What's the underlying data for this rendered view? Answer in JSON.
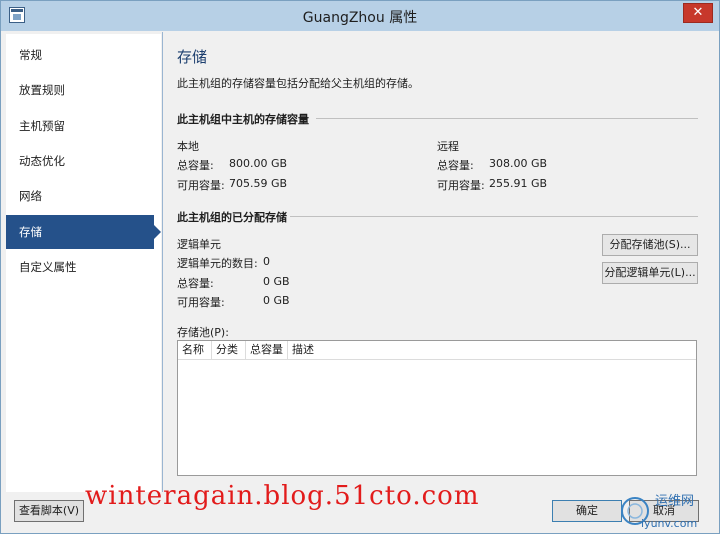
{
  "window": {
    "title": "GuangZhou 属性",
    "close_label": "✕"
  },
  "sidebar": {
    "items": [
      {
        "label": "常规"
      },
      {
        "label": "放置规则"
      },
      {
        "label": "主机预留"
      },
      {
        "label": "动态优化"
      },
      {
        "label": "网络"
      },
      {
        "label": "存储",
        "active": true
      },
      {
        "label": "自定义属性"
      }
    ]
  },
  "main": {
    "title": "存储",
    "description": "此主机组的存储容量包括分配给父主机组的存储。",
    "capacity_section": {
      "heading": "此主机组中主机的存储容量",
      "local": {
        "label": "本地",
        "total_label": "总容量:",
        "total_value": "800.00 GB",
        "available_label": "可用容量:",
        "available_value": "705.59 GB"
      },
      "remote": {
        "label": "远程",
        "total_label": "总容量:",
        "total_value": "308.00 GB",
        "available_label": "可用容量:",
        "available_value": "255.91 GB"
      }
    },
    "allocated_section": {
      "heading": "此主机组的已分配存储",
      "logical_unit_label": "逻辑单元",
      "count_label": "逻辑单元的数目:",
      "count_value": "0",
      "total_label": "总容量:",
      "total_value": "0 GB",
      "available_label": "可用容量:",
      "available_value": "0 GB",
      "allocate_pool_button": "分配存储池(S)...",
      "allocate_lun_button": "分配逻辑单元(L)..."
    },
    "pool": {
      "label": "存储池(P):",
      "columns": [
        "名称",
        "分类",
        "总容量",
        "描述"
      ]
    }
  },
  "footer": {
    "view_script_button": "查看脚本(V)",
    "ok_button": "确定",
    "cancel_button": "取消"
  },
  "overlay": {
    "watermark": "winteragain.blog.51cto.com",
    "logo_text": "运维网",
    "logo_url": "iyunv.com"
  },
  "colors": {
    "accent": "#25518a",
    "titlebar": "#b7d0e6",
    "close": "#c7382b",
    "watermark": "#e21b1b"
  }
}
